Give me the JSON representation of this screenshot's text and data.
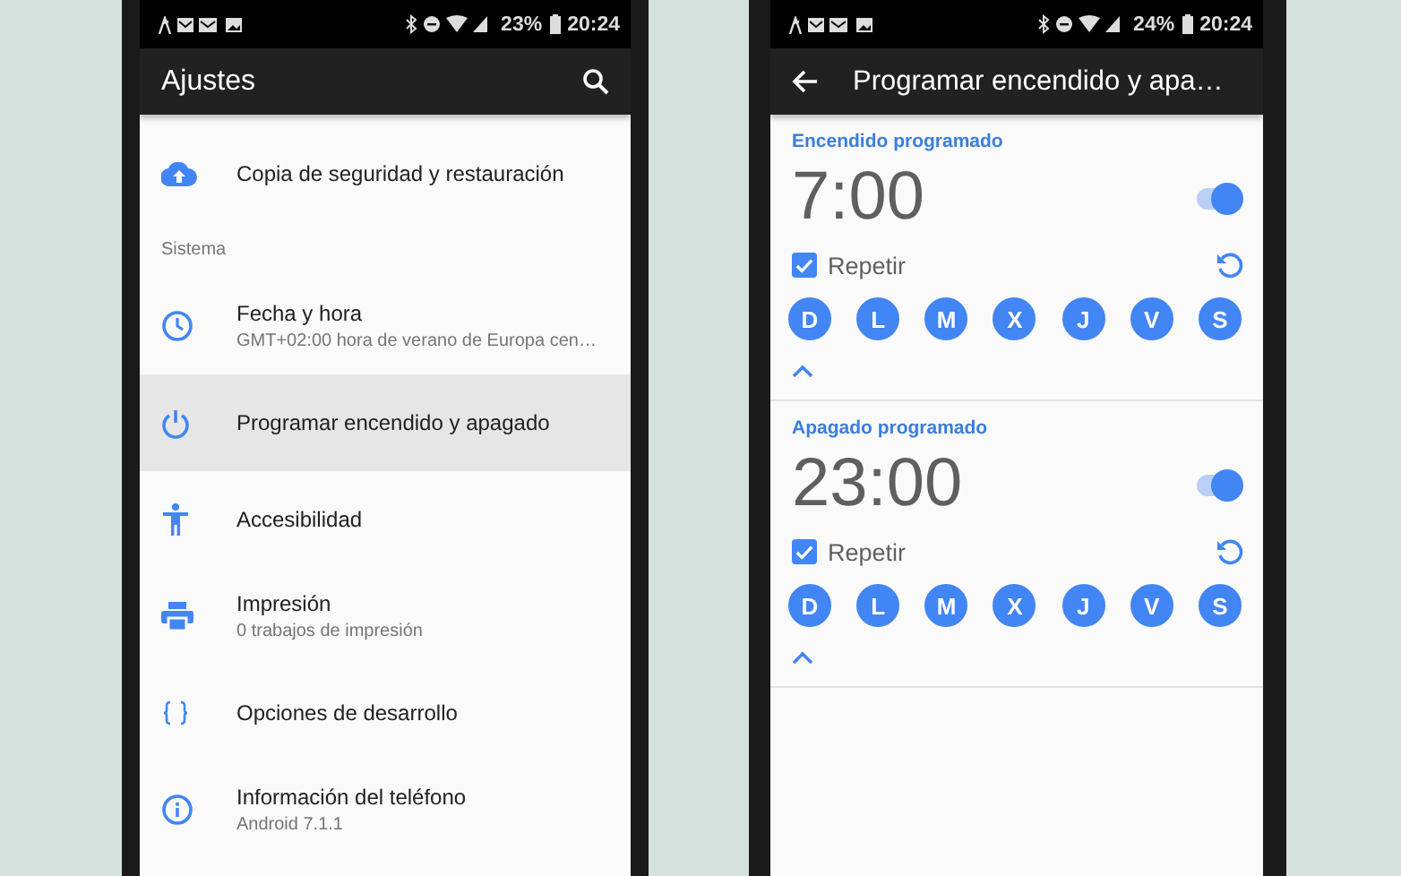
{
  "settings_phone": {
    "status_bar": {
      "battery": "23%",
      "time": "20:24"
    },
    "toolbar": {
      "title": "Ajustes"
    },
    "items": [
      {
        "kind": "item",
        "title": "Copia de seguridad y restauración",
        "selected": false
      },
      {
        "kind": "header",
        "title": "Sistema"
      },
      {
        "kind": "item",
        "title": "Fecha y hora",
        "subtitle": "GMT+02:00 hora de verano de Europa cen…",
        "selected": false
      },
      {
        "kind": "item",
        "title": "Programar encendido y apagado",
        "selected": true
      },
      {
        "kind": "item",
        "title": "Accesibilidad",
        "selected": false
      },
      {
        "kind": "item",
        "title": "Impresión",
        "subtitle": "0 trabajos de impresión",
        "selected": false
      },
      {
        "kind": "item",
        "title": "Opciones de desarrollo",
        "selected": false
      },
      {
        "kind": "item",
        "title": "Información del teléfono",
        "subtitle": "Android 7.1.1",
        "selected": false
      }
    ]
  },
  "schedule_phone": {
    "status_bar": {
      "battery": "24%",
      "time": "20:24"
    },
    "toolbar": {
      "title": "Programar encendido y apa…"
    },
    "schedules": [
      {
        "title": "Encendido programado",
        "time": "7:00",
        "on": true,
        "repeat_label": "Repetir",
        "repeat_checked": true,
        "expanded": true,
        "days": [
          {
            "label": "D",
            "selected": true
          },
          {
            "label": "L",
            "selected": true
          },
          {
            "label": "M",
            "selected": true
          },
          {
            "label": "X",
            "selected": true
          },
          {
            "label": "J",
            "selected": true
          },
          {
            "label": "V",
            "selected": true
          },
          {
            "label": "S",
            "selected": true
          }
        ]
      },
      {
        "title": "Apagado programado",
        "time": "23:00",
        "on": true,
        "repeat_label": "Repetir",
        "repeat_checked": true,
        "expanded": true,
        "days": [
          {
            "label": "D",
            "selected": true
          },
          {
            "label": "L",
            "selected": true
          },
          {
            "label": "M",
            "selected": true
          },
          {
            "label": "X",
            "selected": true
          },
          {
            "label": "J",
            "selected": true
          },
          {
            "label": "V",
            "selected": true
          },
          {
            "label": "S",
            "selected": true
          }
        ]
      }
    ]
  }
}
